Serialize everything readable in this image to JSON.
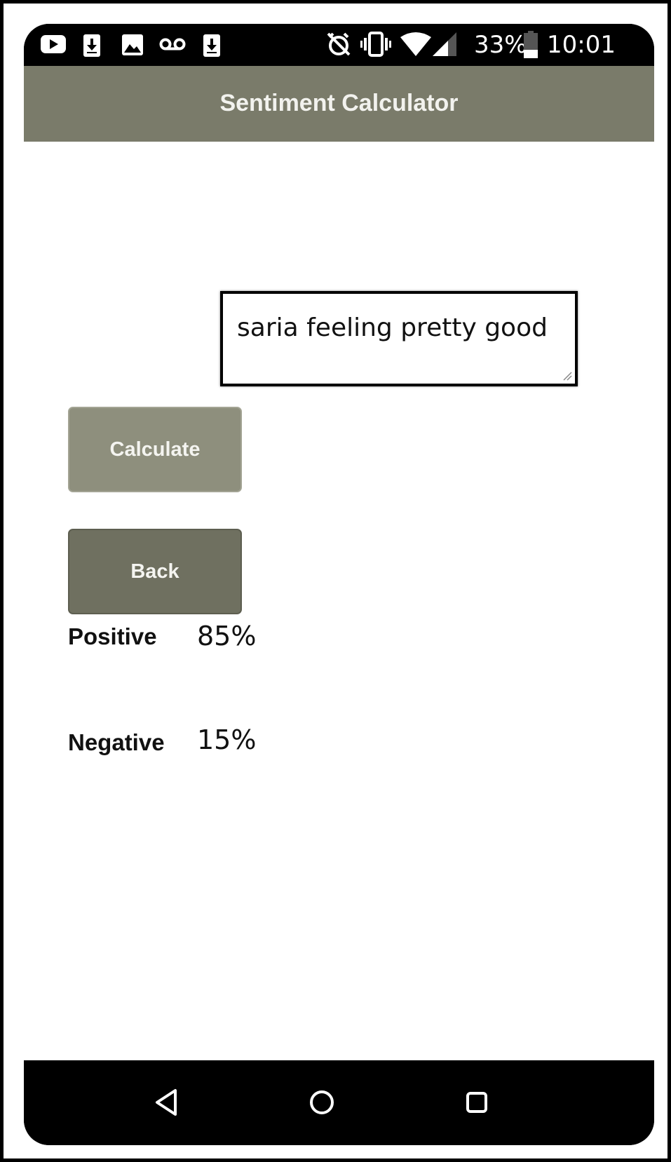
{
  "status_bar": {
    "battery": "33%",
    "time": "10:01",
    "notification_icons": [
      "youtube-icon",
      "download-icon",
      "image-icon",
      "voicemail-icon",
      "download-icon"
    ],
    "system_icons": [
      "alarm-off-icon",
      "vibrate-icon",
      "wifi-icon",
      "signal-icon",
      "battery-icon"
    ]
  },
  "app_bar": {
    "title": "Sentiment Calculator",
    "background_color": "#7a7b6a"
  },
  "input": {
    "value": "saria feeling pretty good"
  },
  "buttons": {
    "calculate_label": "Calculate",
    "back_label": "Back"
  },
  "results": {
    "positive_label": "Positive",
    "positive_value": "85%",
    "negative_label": "Negative",
    "negative_value": "15%"
  },
  "nav_bar": {
    "icons": [
      "back-icon",
      "home-icon",
      "recents-icon"
    ]
  }
}
